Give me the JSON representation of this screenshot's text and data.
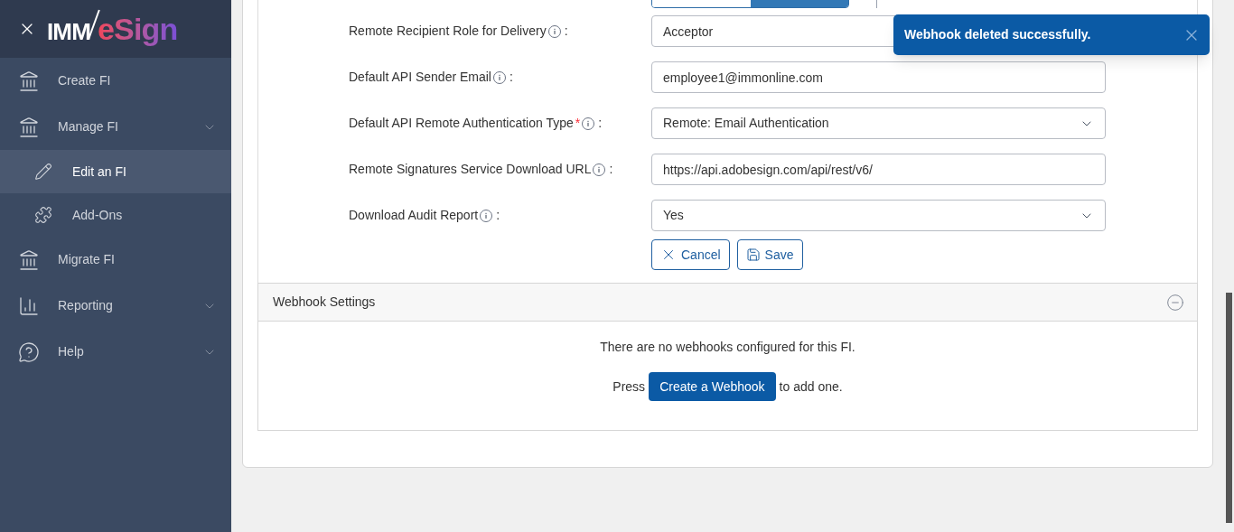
{
  "sidebar": {
    "logo": {
      "left": "IMM",
      "right": "eSign"
    },
    "items": [
      {
        "label": "Create FI",
        "expandable": false,
        "selected": false
      },
      {
        "label": "Manage FI",
        "expandable": true,
        "selected": false,
        "children": [
          {
            "label": "Edit an FI",
            "selected": true
          },
          {
            "label": "Add-Ons",
            "selected": false
          }
        ]
      },
      {
        "label": "Migrate FI",
        "expandable": false,
        "selected": false
      },
      {
        "label": "Reporting",
        "expandable": true,
        "selected": false
      },
      {
        "label": "Help",
        "expandable": true,
        "selected": false
      }
    ]
  },
  "top_toggle": {
    "options": [
      {
        "selected": false
      },
      {
        "selected": true
      }
    ]
  },
  "form": {
    "rows": [
      {
        "kind": "input",
        "label": "Remote Recipient Role for Delivery",
        "colon": ":",
        "value": "Acceptor"
      },
      {
        "kind": "input",
        "label": "Default API Sender Email",
        "colon": ":",
        "value": "employee1@immonline.com"
      },
      {
        "kind": "select",
        "label": "Default API Remote Authentication Type",
        "required_mark": "*",
        "colon": ":",
        "value": "Remote: Email Authentication"
      },
      {
        "kind": "input",
        "label": "Remote Signatures Service Download URL",
        "colon": ":",
        "value": "https://api.adobesign.com/api/rest/v6/"
      },
      {
        "kind": "select",
        "label": "Download Audit Report",
        "colon": ":",
        "value": "Yes"
      }
    ],
    "buttons": [
      {
        "kind": "cancel",
        "label": "Cancel"
      },
      {
        "kind": "save",
        "label": "Save"
      }
    ]
  },
  "webhooks": {
    "title": "Webhook Settings",
    "expanded": true,
    "empty_message": "There are no webhooks configured for this FI.",
    "press_text": "Press",
    "create_button": "Create a Webhook",
    "after_text": "to add one."
  },
  "toast": {
    "message": "Webhook deleted successfully."
  }
}
